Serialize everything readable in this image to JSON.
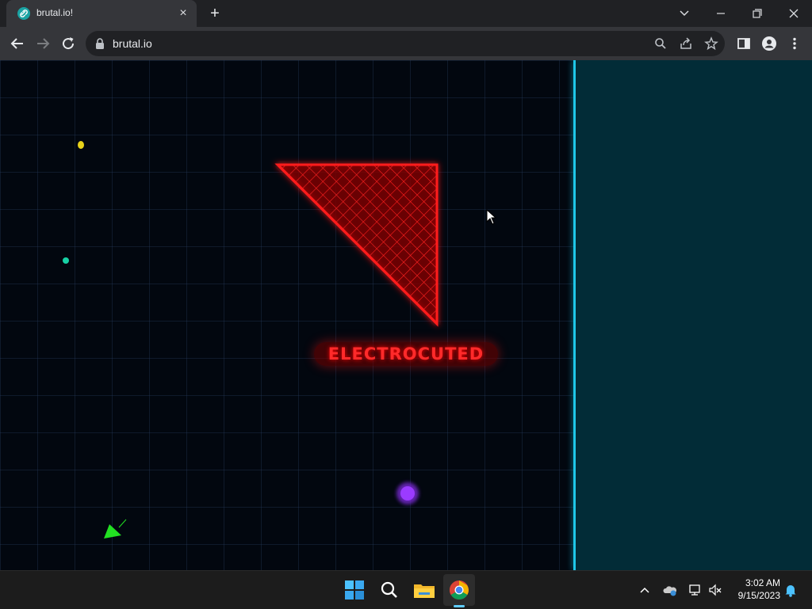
{
  "browser": {
    "tab_title": "brutal.io!",
    "url": "brutal.io",
    "accent": "#35363a"
  },
  "icons": {
    "tab_favicon": "link-icon",
    "tab_close": "close-icon",
    "new_tab": "plus-icon",
    "back": "arrow-left-icon",
    "forward": "arrow-right-icon",
    "reload": "reload-icon",
    "lock": "lock-icon",
    "zoom": "search-icon",
    "share": "share-icon",
    "bookmark": "star-icon",
    "side_panel": "side-panel-icon",
    "profile": "profile-icon",
    "menu": "kebab-menu-icon"
  },
  "game": {
    "status_text": "ELECTROCUTED",
    "colors": {
      "arena_bg": "#02070f",
      "border": "#1fc7e8",
      "outside": "#022c37",
      "hazard": "#ff1a1a",
      "player": "#22e022",
      "orb_purple": "#9b3bff",
      "orb_yellow": "#e8d21a",
      "orb_teal": "#17d1a5"
    }
  },
  "taskbar": {
    "apps": [
      "windows-start-icon",
      "search-icon",
      "file-explorer-icon",
      "chrome-icon"
    ],
    "tray": [
      "chevron-up-icon",
      "onedrive-icon",
      "network-icon",
      "speaker-muted-icon",
      "bell-icon"
    ],
    "time": "3:02 AM",
    "date": "9/15/2023"
  }
}
